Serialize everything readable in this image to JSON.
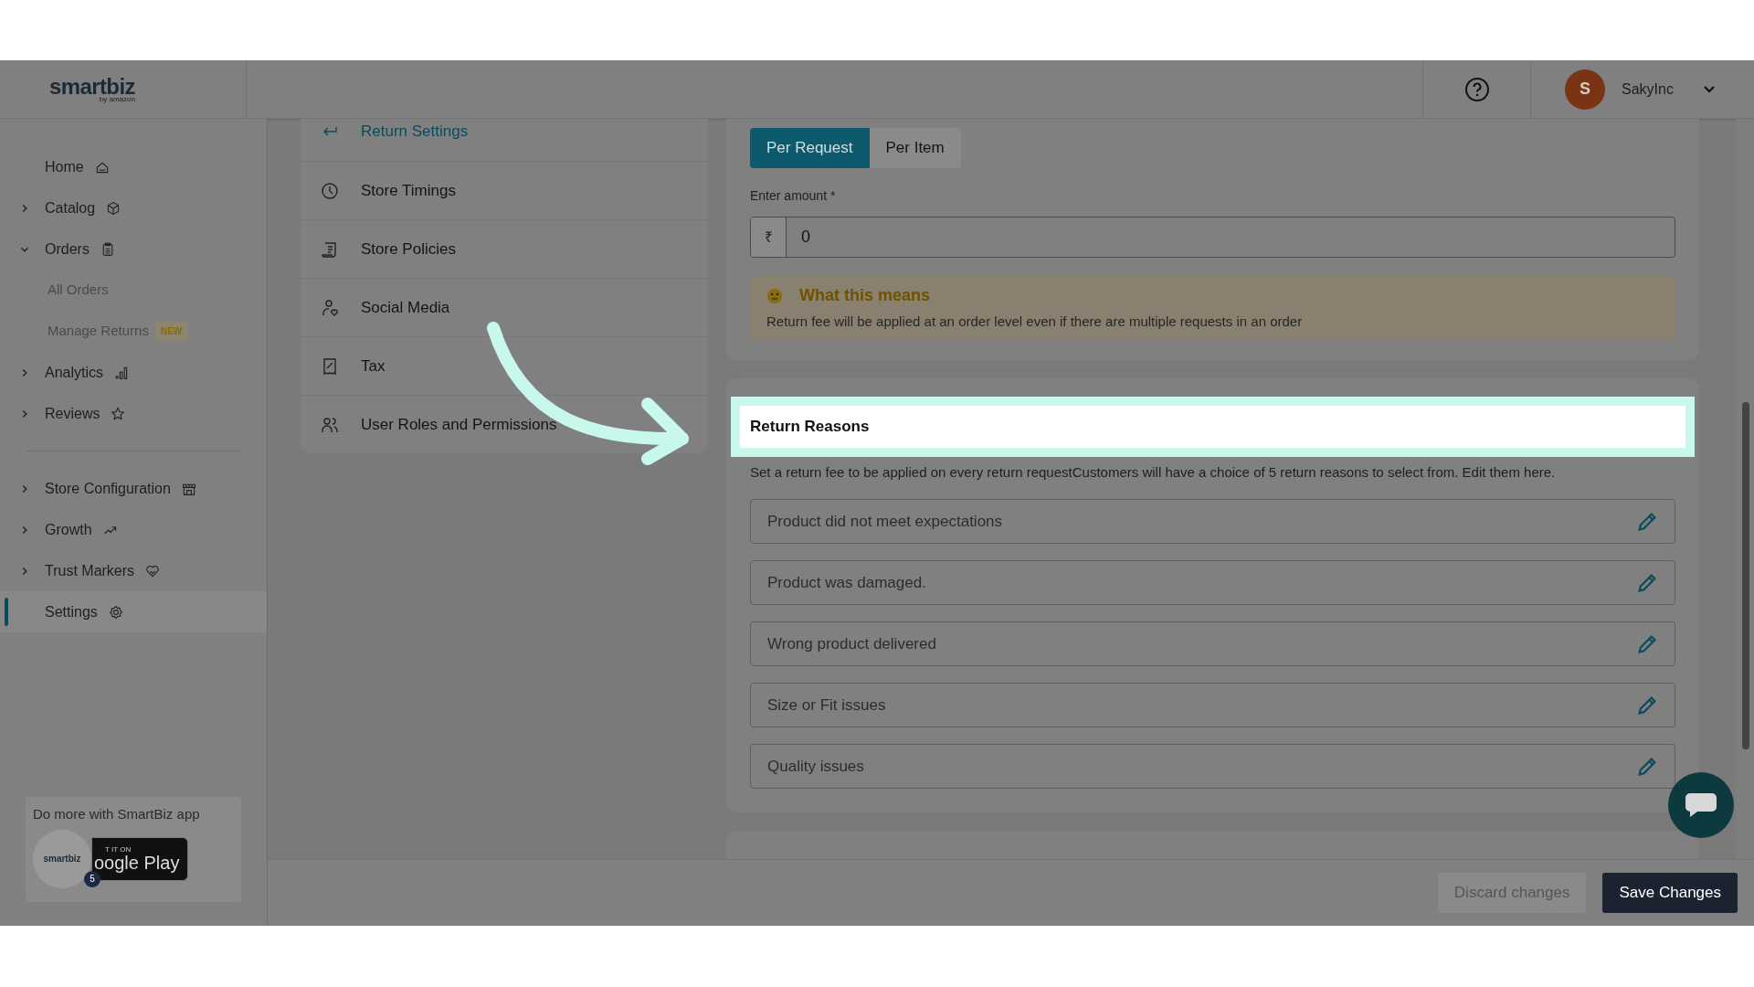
{
  "header": {
    "logo": {
      "brand": "smartbiz",
      "byline": "by amazon"
    },
    "user": {
      "initial": "S",
      "name": "SakyInc"
    }
  },
  "sidebar": {
    "groups": [
      [
        {
          "label": "Home",
          "expandable": false,
          "selected": false
        },
        {
          "label": "Catalog",
          "expandable": true,
          "expanded": false,
          "selected": false
        },
        {
          "label": "Orders",
          "expandable": true,
          "expanded": true,
          "selected": false,
          "children": [
            {
              "label": "All Orders"
            },
            {
              "label": "Manage Returns",
              "badge": "NEW"
            }
          ]
        },
        {
          "label": "Analytics",
          "expandable": true,
          "expanded": false,
          "selected": false
        },
        {
          "label": "Reviews",
          "expandable": true,
          "expanded": false,
          "selected": false
        }
      ],
      [
        {
          "label": "Store Configuration",
          "expandable": true,
          "expanded": false,
          "selected": false
        },
        {
          "label": "Growth",
          "expandable": true,
          "expanded": false,
          "selected": false
        },
        {
          "label": "Trust Markers",
          "expandable": true,
          "expanded": false,
          "selected": false
        },
        {
          "label": "Settings",
          "expandable": false,
          "selected": true
        }
      ]
    ],
    "promo": {
      "text": "Do more with SmartBiz app",
      "store_badge": {
        "small": "T IT ON",
        "large": "oogle Play"
      },
      "app_logo": "smartbiz",
      "count": "5"
    }
  },
  "settings_nav": [
    {
      "label": "Return Settings",
      "selected": true
    },
    {
      "label": "Store Timings",
      "selected": false
    },
    {
      "label": "Store Policies",
      "selected": false
    },
    {
      "label": "Social Media",
      "selected": false
    },
    {
      "label": "Tax",
      "selected": false
    },
    {
      "label": "User Roles and Permissions",
      "selected": false
    }
  ],
  "return_fee": {
    "tabs": [
      {
        "label": "Per Request",
        "selected": true
      },
      {
        "label": "Per Item",
        "selected": false
      }
    ],
    "amount": {
      "label": "Enter amount *",
      "currency": "₹",
      "value": "0"
    },
    "info": {
      "title": "What this means",
      "text": "Return fee will be applied at an order level even if there are multiple requests in an order"
    }
  },
  "return_reasons": {
    "title": "Return Reasons",
    "highlighted": true,
    "description": "Set a return fee to be applied on every return requestCustomers will have a choice of 5 return reasons to select from. Edit them here.",
    "reasons": [
      "Product did not meet expectations",
      "Product was damaged.",
      "Wrong product delivered",
      "Size or Fit issues",
      "Quality issues"
    ]
  },
  "footer": {
    "buttons": [
      {
        "label": "Discard changes",
        "disabled": true
      },
      {
        "label": "Save Changes",
        "disabled": false
      }
    ]
  }
}
